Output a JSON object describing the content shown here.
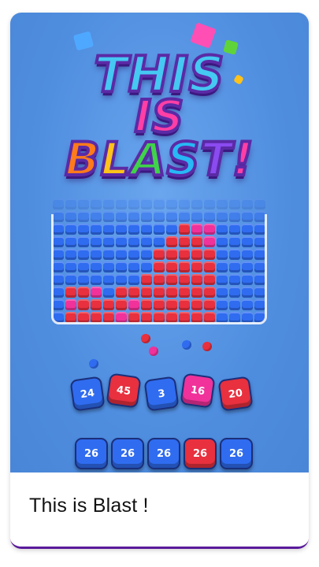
{
  "logo": {
    "line1": "THIS",
    "line2": "IS",
    "line3_letters": [
      "B",
      "L",
      "A",
      "S",
      "T",
      "!"
    ],
    "line3_colors": [
      "#ff7a1a",
      "#ffc21a",
      "#3fd24a",
      "#27b8f5",
      "#8a4bf0",
      "#ff3fa5"
    ]
  },
  "colors": {
    "blue_block": "#2f6cf0",
    "red_block": "#e8303e",
    "pink_block": "#f0329a",
    "background": "#4f8ddf",
    "caption_border": "#5a1a9c"
  },
  "shooters": [
    {
      "value": "24",
      "color": "#2f6cf0"
    },
    {
      "value": "45",
      "color": "#e8303e"
    },
    {
      "value": "3",
      "color": "#2f6cf0"
    },
    {
      "value": "16",
      "color": "#f0329a"
    },
    {
      "value": "20",
      "color": "#e8303e"
    }
  ],
  "queue": [
    {
      "value": "26",
      "color": "#2f6cf0"
    },
    {
      "value": "26",
      "color": "#2f6cf0"
    },
    {
      "value": "26",
      "color": "#2f6cf0"
    },
    {
      "value": "26",
      "color": "#e8303e"
    },
    {
      "value": "26",
      "color": "#2f6cf0"
    }
  ],
  "caption": {
    "title": "This is Blast !"
  }
}
